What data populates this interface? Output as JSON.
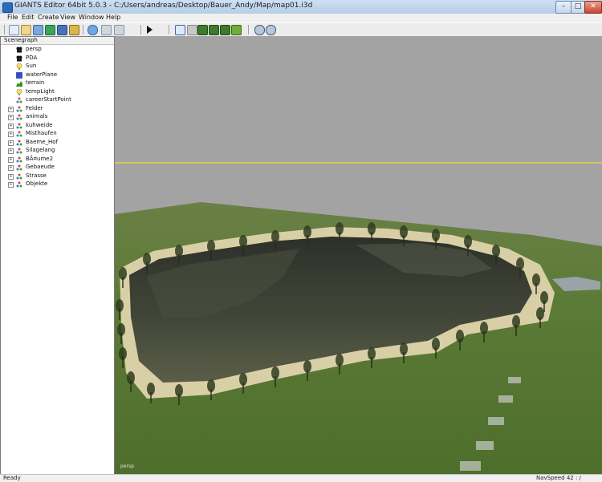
{
  "window": {
    "title": "GIANTS Editor 64bit 5.0.3 - C:/Users/andreas/Desktop/Bauer_Andy/Map/map01.i3d"
  },
  "menu": [
    "File",
    "Edit",
    "Create",
    "View",
    "Window",
    "Help"
  ],
  "toolbar": {
    "buttons": [
      "new-icon",
      "open-icon",
      "import-icon",
      "export-icon",
      "save-icon",
      "save-all-icon",
      "refresh-icon",
      "undo-icon",
      "redo-icon",
      "play-icon",
      "select-tool-icon",
      "move-tool-icon",
      "terrain-sculpt-icon",
      "terrain-paint-icon",
      "terrain-smooth-icon",
      "foliage-paint-icon",
      "settings-icon",
      "render-settings-icon"
    ]
  },
  "scenegraph": {
    "header": "Scenegraph",
    "nodes": [
      {
        "label": "persp",
        "icon": "camera-icon",
        "expandable": false
      },
      {
        "label": "PDA",
        "icon": "camera-icon",
        "expandable": false
      },
      {
        "label": "Sun",
        "icon": "light-icon",
        "expandable": false
      },
      {
        "label": "waterPlane",
        "icon": "shape-icon",
        "expandable": false
      },
      {
        "label": "terrain",
        "icon": "terrain-icon",
        "expandable": false
      },
      {
        "label": "tempLight",
        "icon": "light-icon",
        "expandable": false
      },
      {
        "label": "careerStartPoint",
        "icon": "transform-group-icon",
        "expandable": false
      },
      {
        "label": "Felder",
        "icon": "transform-group-icon",
        "expandable": true
      },
      {
        "label": "animals",
        "icon": "transform-group-icon",
        "expandable": true
      },
      {
        "label": "kuhweide",
        "icon": "transform-group-icon",
        "expandable": true
      },
      {
        "label": "Misthaufen",
        "icon": "transform-group-icon",
        "expandable": true
      },
      {
        "label": "Baeme_Hof",
        "icon": "transform-group-icon",
        "expandable": true
      },
      {
        "label": "Silagelang",
        "icon": "transform-group-icon",
        "expandable": true
      },
      {
        "label": "BÃ¤ume2",
        "icon": "transform-group-icon",
        "expandable": true
      },
      {
        "label": "Gebaeude",
        "icon": "transform-group-icon",
        "expandable": true
      },
      {
        "label": "Strasse",
        "icon": "transform-group-icon",
        "expandable": true
      },
      {
        "label": "Objekte",
        "icon": "transform-group-icon",
        "expandable": true
      }
    ]
  },
  "viewport": {
    "camera_label": "persp",
    "colors": {
      "sky": "#a3a3a3",
      "grass": "#5f7a3a",
      "pit": "#3a3d34",
      "path": "#d9cfa6",
      "horizon_line": "#e8e030"
    }
  },
  "statusbar": {
    "left": "Ready",
    "right": "NavSpeed 42  :  /"
  }
}
